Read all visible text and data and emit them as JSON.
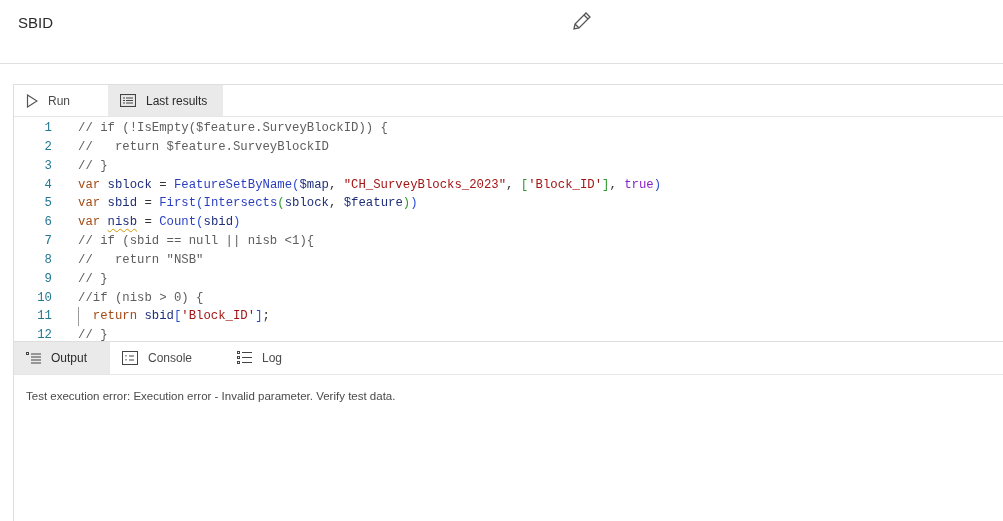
{
  "header": {
    "title": "SBID"
  },
  "toolbar": {
    "items": [
      {
        "label": "Run",
        "kind": "run",
        "selected": false
      },
      {
        "label": "Last results",
        "kind": "results",
        "selected": true
      }
    ]
  },
  "editor": {
    "lines": [
      {
        "number": "1",
        "indent_guide": false,
        "tokens": [
          {
            "kind": "comment",
            "text": "// if (!IsEmpty($feature.SurveyBlockID)) {"
          }
        ]
      },
      {
        "number": "2",
        "indent_guide": false,
        "tokens": [
          {
            "kind": "comment",
            "text": "//   return $feature.SurveyBlockID"
          }
        ]
      },
      {
        "number": "3",
        "indent_guide": false,
        "tokens": [
          {
            "kind": "comment",
            "text": "// }"
          }
        ]
      },
      {
        "number": "4",
        "indent_guide": false,
        "tokens": [
          {
            "kind": "keyword",
            "text": "var "
          },
          {
            "kind": "name",
            "text": "sblock"
          },
          {
            "kind": "plain",
            "text": " = "
          },
          {
            "kind": "function",
            "text": "FeatureSetByName"
          },
          {
            "kind": "bracket1",
            "text": "("
          },
          {
            "kind": "name",
            "text": "$map"
          },
          {
            "kind": "plain",
            "text": ", "
          },
          {
            "kind": "string",
            "text": "\"CH_SurveyBlocks_2023\""
          },
          {
            "kind": "plain",
            "text": ", "
          },
          {
            "kind": "bracket2",
            "text": "["
          },
          {
            "kind": "string",
            "text": "'Block_ID'"
          },
          {
            "kind": "bracket2",
            "text": "]"
          },
          {
            "kind": "plain",
            "text": ", "
          },
          {
            "kind": "literal",
            "text": "true"
          },
          {
            "kind": "bracket1",
            "text": ")"
          }
        ]
      },
      {
        "number": "5",
        "indent_guide": false,
        "tokens": [
          {
            "kind": "keyword",
            "text": "var "
          },
          {
            "kind": "name",
            "text": "sbid"
          },
          {
            "kind": "plain",
            "text": " = "
          },
          {
            "kind": "function",
            "text": "First"
          },
          {
            "kind": "bracket1",
            "text": "("
          },
          {
            "kind": "function",
            "text": "Intersects"
          },
          {
            "kind": "bracket2",
            "text": "("
          },
          {
            "kind": "name",
            "text": "sblock"
          },
          {
            "kind": "plain",
            "text": ", "
          },
          {
            "kind": "name",
            "text": "$feature"
          },
          {
            "kind": "bracket2",
            "text": ")"
          },
          {
            "kind": "bracket1",
            "text": ")"
          }
        ]
      },
      {
        "number": "6",
        "indent_guide": false,
        "tokens": [
          {
            "kind": "keyword",
            "text": "var "
          },
          {
            "kind": "name",
            "text": "nisb",
            "warning": true
          },
          {
            "kind": "plain",
            "text": " = "
          },
          {
            "kind": "function",
            "text": "Count"
          },
          {
            "kind": "bracket1",
            "text": "("
          },
          {
            "kind": "name",
            "text": "sbid"
          },
          {
            "kind": "bracket1",
            "text": ")"
          }
        ]
      },
      {
        "number": "7",
        "indent_guide": false,
        "tokens": [
          {
            "kind": "comment",
            "text": "// if (sbid == null || nisb <1){"
          }
        ]
      },
      {
        "number": "8",
        "indent_guide": false,
        "tokens": [
          {
            "kind": "comment",
            "text": "//   return \"NSB\""
          }
        ]
      },
      {
        "number": "9",
        "indent_guide": false,
        "tokens": [
          {
            "kind": "comment",
            "text": "// }"
          }
        ]
      },
      {
        "number": "10",
        "indent_guide": false,
        "tokens": [
          {
            "kind": "comment",
            "text": "//if (nisb > 0) {"
          }
        ]
      },
      {
        "number": "11",
        "indent_guide": true,
        "tokens": [
          {
            "kind": "keyword",
            "text": "return "
          },
          {
            "kind": "name",
            "text": "sbid"
          },
          {
            "kind": "bracket1",
            "text": "["
          },
          {
            "kind": "string",
            "text": "'Block_ID'"
          },
          {
            "kind": "bracket1",
            "text": "]"
          },
          {
            "kind": "plain",
            "text": ";"
          }
        ]
      },
      {
        "number": "12",
        "indent_guide": false,
        "tokens": [
          {
            "kind": "comment",
            "text": "// }"
          }
        ]
      }
    ]
  },
  "output_panel": {
    "tabs": [
      {
        "label": "Output",
        "kind": "output",
        "selected": true
      },
      {
        "label": "Console",
        "kind": "console",
        "selected": false
      },
      {
        "label": "Log",
        "kind": "log",
        "selected": false
      }
    ],
    "message": "Test execution error: Execution error - Invalid parameter. Verify test data."
  }
}
